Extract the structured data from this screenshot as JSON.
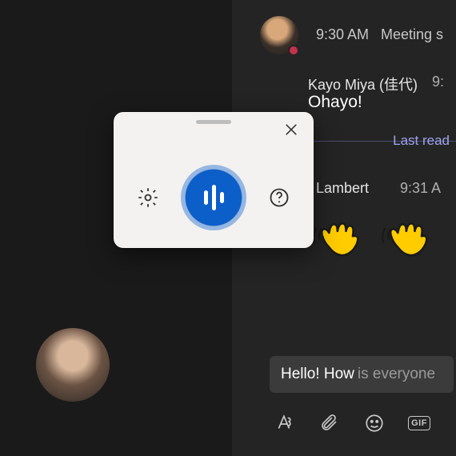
{
  "messages": {
    "m1": {
      "time": "9:30 AM",
      "label": "Meeting s"
    },
    "m2": {
      "name": "Kayo Miya (佳代)",
      "time": "9:",
      "text": "Ohayo!"
    },
    "divider": {
      "label": "Last read"
    },
    "m3": {
      "name": "n Lambert",
      "time": "9:31 A"
    }
  },
  "compose": {
    "typed": "Hello! How",
    "rest": "is everyone"
  },
  "toolbar": {
    "gif": "GIF"
  },
  "icons": {
    "format": "format-icon",
    "attach": "attach-icon",
    "emoji": "emoji-icon",
    "gif": "gif-icon",
    "sticker": "sticker-icon",
    "settings": "gear-icon",
    "help": "help-icon",
    "close": "close-icon",
    "mic": "mic-icon",
    "wave": "wave-emoji"
  }
}
